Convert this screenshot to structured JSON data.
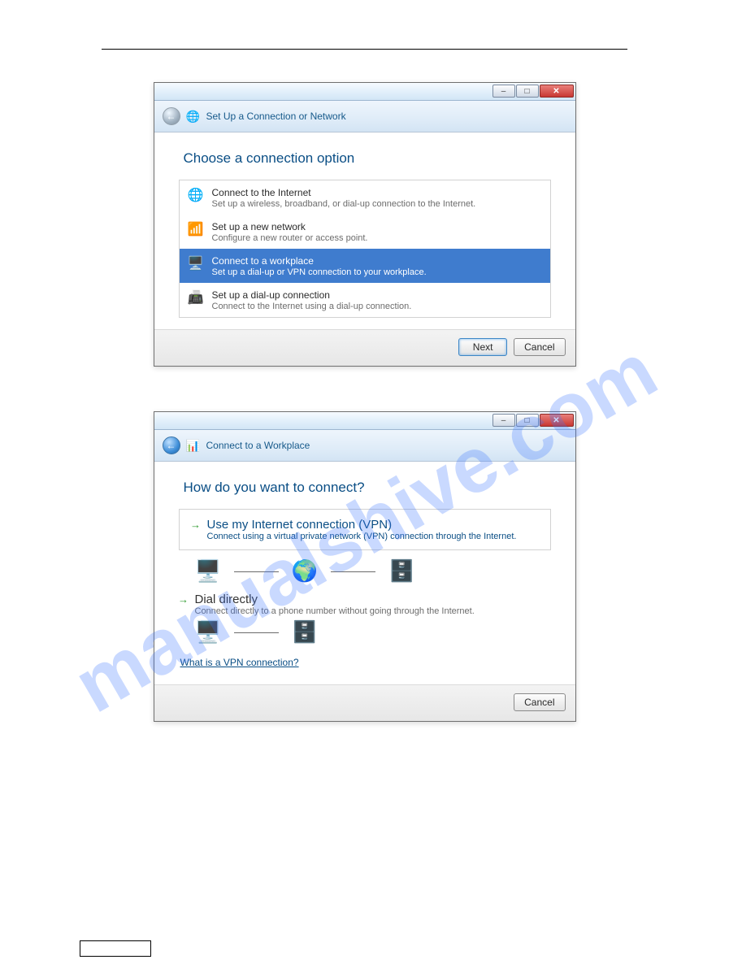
{
  "watermark": "manualshive.com",
  "dialog1": {
    "window_title": "Set Up a Connection or Network",
    "section_title": "Choose a connection option",
    "options": [
      {
        "title": "Connect to the Internet",
        "sub": "Set up a wireless, broadband, or dial-up connection to the Internet.",
        "icon": "🌐"
      },
      {
        "title": "Set up a new network",
        "sub": "Configure a new router or access point.",
        "icon": "📶"
      },
      {
        "title": "Connect to a workplace",
        "sub": "Set up a dial-up or VPN connection to your workplace.",
        "icon": "🖥️"
      },
      {
        "title": "Set up a dial-up connection",
        "sub": "Connect to the Internet using a dial-up connection.",
        "icon": "📠"
      }
    ],
    "selected_index": 2,
    "next_label": "Next",
    "cancel_label": "Cancel"
  },
  "dialog2": {
    "window_title": "Connect to a Workplace",
    "section_title": "How do you want to connect?",
    "vpn": {
      "title": "Use my Internet connection (VPN)",
      "sub": "Connect using a virtual private network (VPN) connection through the Internet."
    },
    "dial": {
      "title": "Dial directly",
      "sub": "Connect directly to a phone number without going through the Internet."
    },
    "help_link": "What is a VPN connection?",
    "cancel_label": "Cancel"
  },
  "icons": {
    "pc": "🖥️",
    "globe": "🌍",
    "server": "🗄️",
    "bars": "📊",
    "back": "←",
    "min": "–",
    "max": "□",
    "close": "✕"
  }
}
